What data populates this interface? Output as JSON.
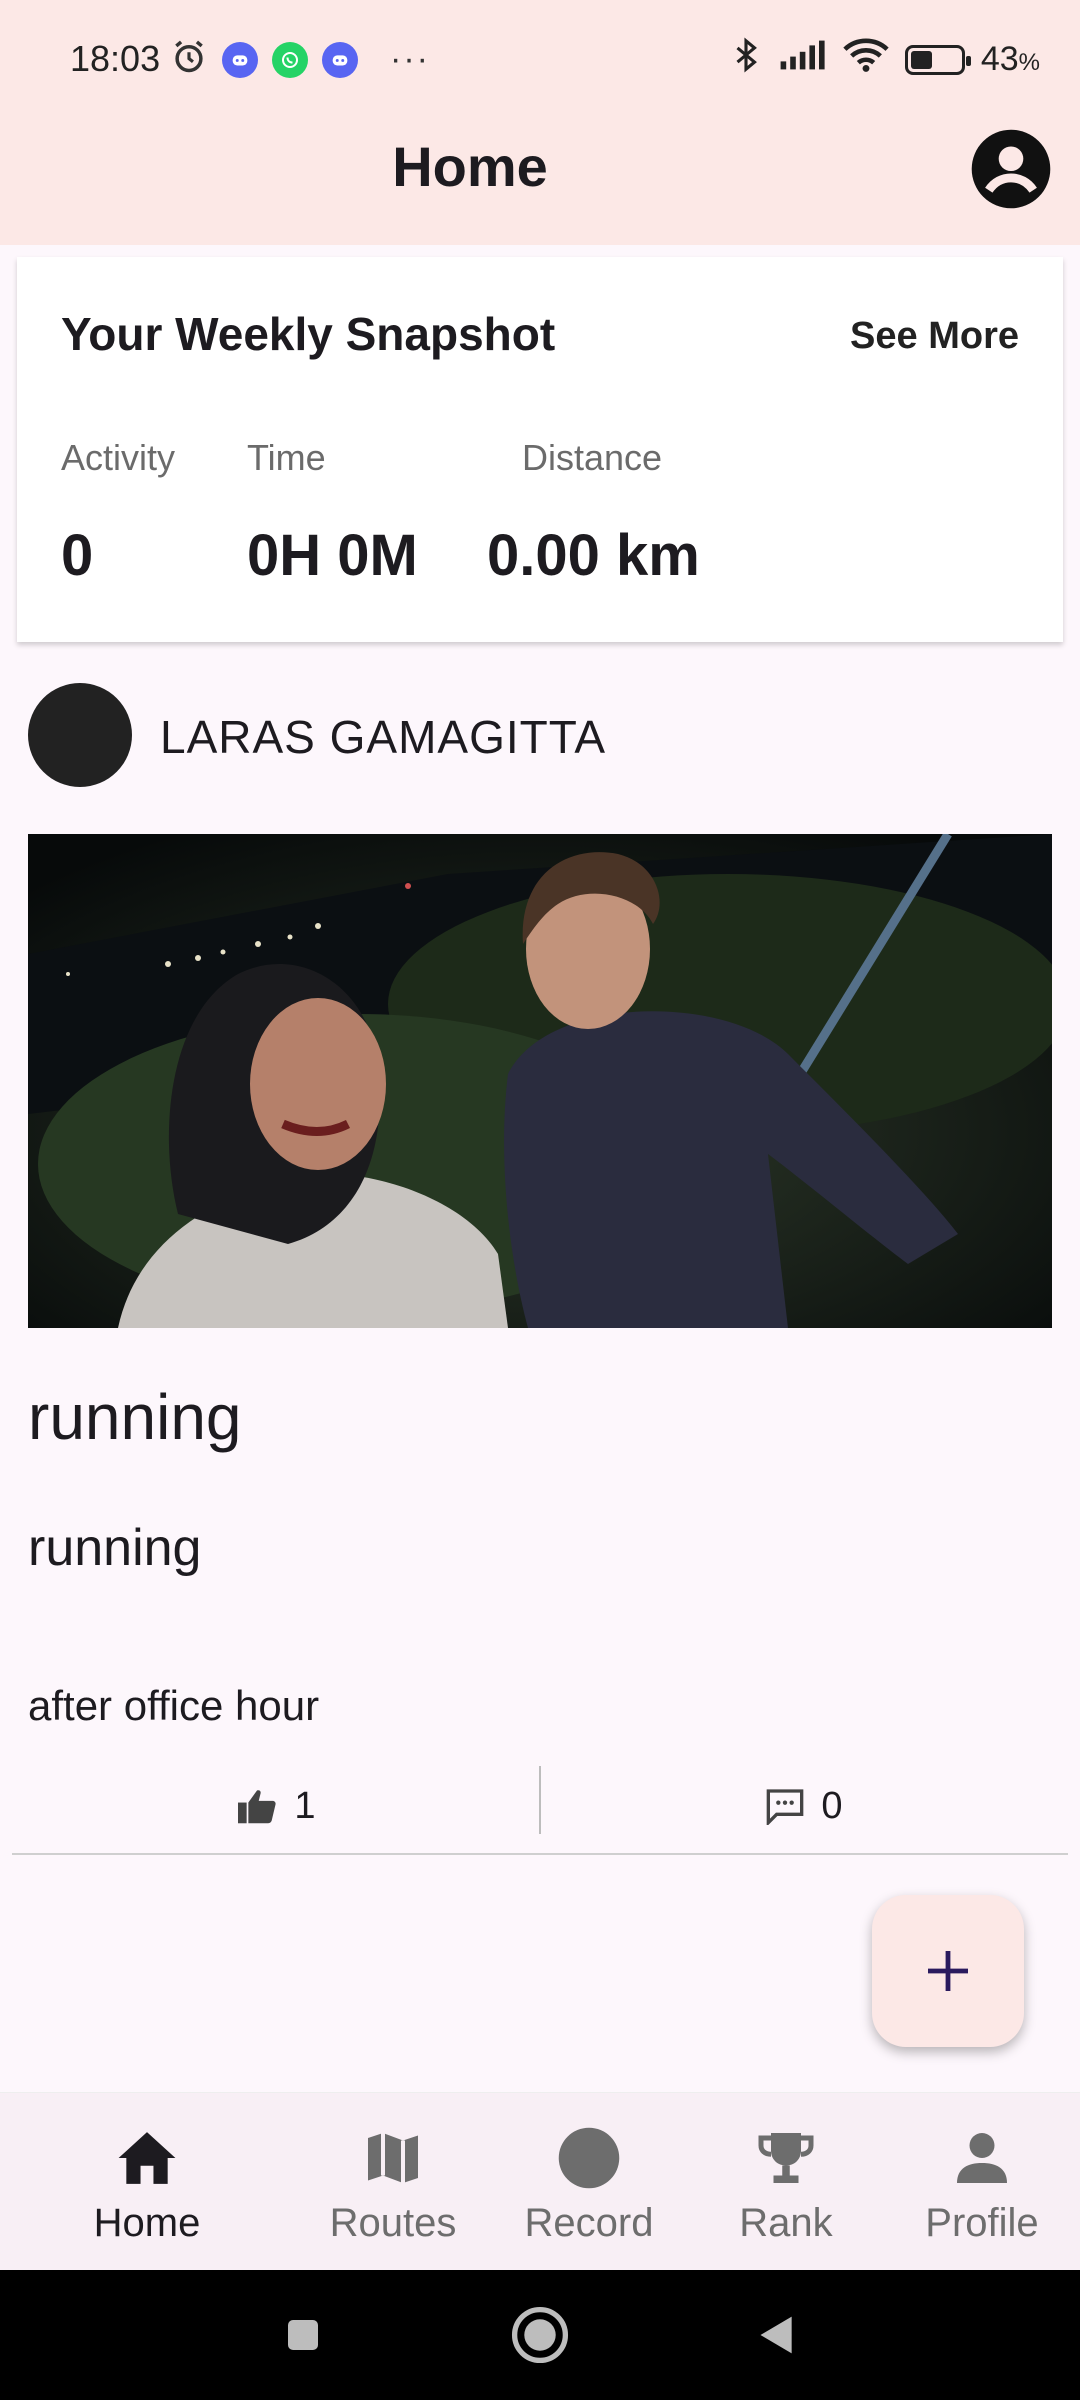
{
  "status_bar": {
    "time": "18:03",
    "battery_percent": "43",
    "battery_unit": "%",
    "battery_level": 0.43,
    "more_label": "···"
  },
  "app_bar": {
    "title": "Home"
  },
  "snapshot": {
    "title": "Your Weekly Snapshot",
    "see_more": "See More",
    "stats": [
      {
        "label": "Activity",
        "value": "0"
      },
      {
        "label": "Time",
        "value": "0H 0M"
      },
      {
        "label": "Distance",
        "value": "0.00 km"
      }
    ]
  },
  "post": {
    "user_name": "LARAS GAMAGITTA",
    "title": "running",
    "activity_type": "running",
    "description": "after office hour",
    "likes": "1",
    "comments": "0"
  },
  "bottom_nav": {
    "items": [
      {
        "label": "Home",
        "icon": "home-icon",
        "active": true
      },
      {
        "label": "Routes",
        "icon": "map-icon",
        "active": false
      },
      {
        "label": "Record",
        "icon": "record-icon",
        "active": false
      },
      {
        "label": "Rank",
        "icon": "trophy-icon",
        "active": false
      },
      {
        "label": "Profile",
        "icon": "person-icon",
        "active": false
      }
    ]
  },
  "colors": {
    "app_bar_bg": "#fce8e6",
    "page_bg": "#fdf7fc",
    "fab_plus": "#2a1a5e"
  }
}
